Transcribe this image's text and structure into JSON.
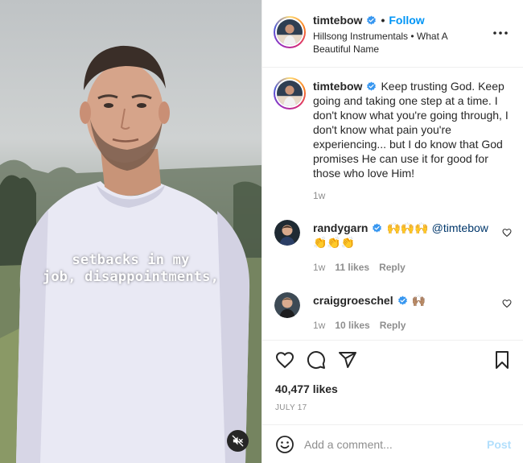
{
  "media": {
    "caption_lines": [
      "setbacks in my",
      "job, disappointments,"
    ],
    "mute_icon": "speaker-muted-icon"
  },
  "header": {
    "username": "timtebow",
    "separator": "•",
    "follow_label": "Follow",
    "audio": "Hillsong Instrumentals • What A Beautiful Name",
    "more_icon": "ellipsis-icon"
  },
  "post": {
    "username": "timtebow",
    "text": "Keep trusting God. Keep going and taking one step at a time. I don't know what you're going through, I don't know what pain you're experiencing... but I do know that God promises He can use it for good for those who love Him!",
    "time": "1w"
  },
  "comments": [
    {
      "username": "randygarn",
      "emoji_text": "🙌🙌🙌",
      "mention": "@timtebow",
      "emoji_text_2": "👏👏👏",
      "time": "1w",
      "likes": "11 likes",
      "reply": "Reply"
    },
    {
      "username": "craiggroeschel",
      "emoji_text": "🙌🏽",
      "time": "1w",
      "likes": "10 likes",
      "reply": "Reply"
    }
  ],
  "actions": {
    "likes": "40,477 likes",
    "date": "JULY 17"
  },
  "add_comment": {
    "placeholder": "Add a comment...",
    "post_label": "Post"
  },
  "colors": {
    "accent": "#0095f6",
    "verified": "#3897f0",
    "post_disabled": "#b2dffc",
    "muted_text": "#8e8e8e"
  }
}
